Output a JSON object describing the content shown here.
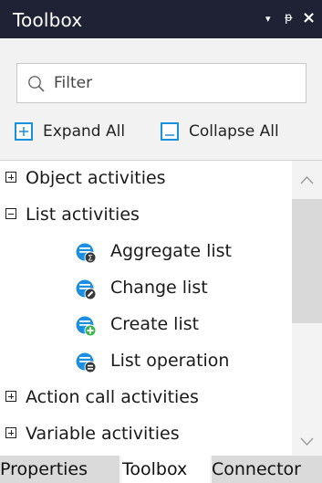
{
  "window": {
    "title": "Toolbox",
    "controls": {
      "dropdown": "▾",
      "pin": "ᵽ",
      "close": "×"
    }
  },
  "search": {
    "placeholder": "Filter",
    "value": ""
  },
  "toolbar": {
    "expand_label": "Expand All",
    "collapse_label": "Collapse All"
  },
  "tree": {
    "items": [
      {
        "label": "Object activities",
        "state": "collapsed"
      },
      {
        "label": "List activities",
        "state": "expanded"
      },
      {
        "label": "Aggregate list",
        "icon": "aggregate-list-icon"
      },
      {
        "label": "Change list",
        "icon": "change-list-icon"
      },
      {
        "label": "Create list",
        "icon": "create-list-icon"
      },
      {
        "label": "List operation",
        "icon": "list-operation-icon"
      },
      {
        "label": "Action call activities",
        "state": "collapsed"
      },
      {
        "label": "Variable activities",
        "state": "collapsed"
      }
    ]
  },
  "tabs": [
    {
      "label": "Properties",
      "active": false
    },
    {
      "label": "Toolbox",
      "active": true
    },
    {
      "label": "Connector",
      "active": false
    }
  ],
  "colors": {
    "titlebar": "#1e2234",
    "accent": "#1b8fe0",
    "green": "#3cb54a",
    "dark_badge": "#3a3a3a"
  }
}
